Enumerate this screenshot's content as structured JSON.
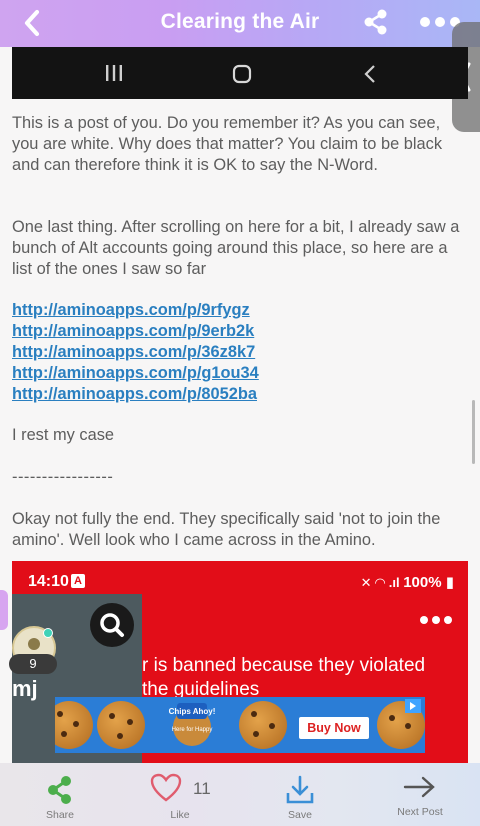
{
  "header": {
    "title": "Clearing the Air",
    "back_icon": "chevron-left-icon",
    "share_icon": "share-icon",
    "more_icon": "more-horizontal-icon",
    "gradient_colors": [
      "#cfa4f0",
      "#a9b7f6"
    ]
  },
  "post": {
    "paragraph1": "This is a post of you. Do you remember it? As you can see, you are white. Why does that matter? You claim to be black and can therefore think it is OK to say the N-Word.",
    "paragraph2": "One last thing. After scrolling on here for a bit, I already saw a bunch of Alt accounts going around this place, so here are a list of the ones I saw so far",
    "links": [
      "http://aminoapps.com/p/9rfygz",
      "http://aminoapps.com/p/9erb2k",
      "http://aminoapps.com/p/36z8k7",
      "http://aminoapps.com/p/g1ou34",
      "http://aminoapps.com/p/8052ba"
    ],
    "rest": "I rest my case",
    "divider": "-----------------",
    "paragraph3": "Okay not fully the end. They specifically said 'not to join the amino'. Well look who I came across in the Amino.",
    "link_color": "#2a7fc0"
  },
  "embedded_screenshot": {
    "time": "14:10",
    "time_badge": "A",
    "status": "100%",
    "message_line1": "r is banned because they violated",
    "message_line2": "the guidelines",
    "side_text": "mj",
    "background": "#e20d18"
  },
  "ad": {
    "brand": "Chips Ahoy!",
    "tagline": "Here for Happy",
    "cta": "Buy Now"
  },
  "floating": {
    "count": "9"
  },
  "bottom_bar": {
    "share_label": "Share",
    "like_label": "Like",
    "like_count": "11",
    "save_label": "Save",
    "next_label": "Next Post",
    "share_color": "#4cae4c",
    "like_color": "#e05c6e",
    "save_color": "#3a8fd6"
  }
}
